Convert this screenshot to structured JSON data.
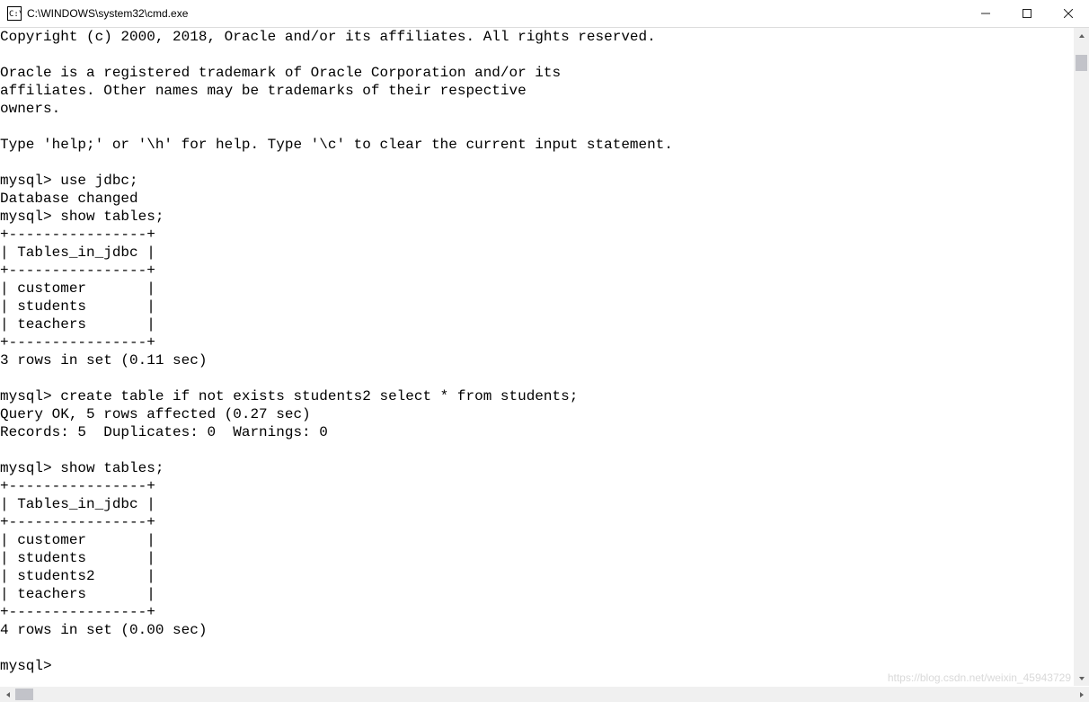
{
  "window": {
    "title": "C:\\WINDOWS\\system32\\cmd.exe"
  },
  "console_text": "Copyright (c) 2000, 2018, Oracle and/or its affiliates. All rights reserved.\n\nOracle is a registered trademark of Oracle Corporation and/or its\naffiliates. Other names may be trademarks of their respective\nowners.\n\nType 'help;' or '\\h' for help. Type '\\c' to clear the current input statement.\n\nmysql> use jdbc;\nDatabase changed\nmysql> show tables;\n+----------------+\n| Tables_in_jdbc |\n+----------------+\n| customer       |\n| students       |\n| teachers       |\n+----------------+\n3 rows in set (0.11 sec)\n\nmysql> create table if not exists students2 select * from students;\nQuery OK, 5 rows affected (0.27 sec)\nRecords: 5  Duplicates: 0  Warnings: 0\n\nmysql> show tables;\n+----------------+\n| Tables_in_jdbc |\n+----------------+\n| customer       |\n| students       |\n| students2      |\n| teachers       |\n+----------------+\n4 rows in set (0.00 sec)\n\nmysql>",
  "watermark": "https://blog.csdn.net/weixin_45943729"
}
